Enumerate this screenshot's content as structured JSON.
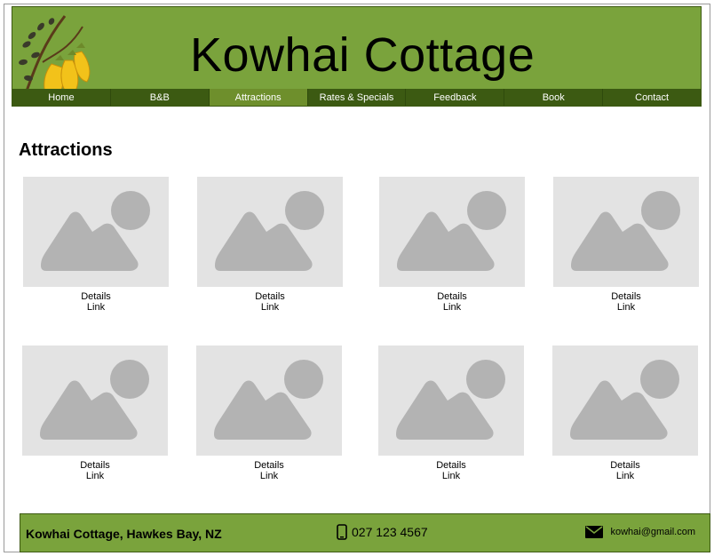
{
  "site": {
    "title": "Kowhai Cottage",
    "brand_color": "#7aa33c",
    "nav_color": "#3c5a12",
    "active_nav_color": "#6e8f2c"
  },
  "nav": {
    "items": [
      {
        "label": "Home"
      },
      {
        "label": "B&B"
      },
      {
        "label": "Attractions",
        "active": true
      },
      {
        "label": "Rates & Specials"
      },
      {
        "label": "Feedback"
      },
      {
        "label": "Book"
      },
      {
        "label": "Contact"
      }
    ]
  },
  "main": {
    "heading": "Attractions",
    "cards": [
      {
        "details": "Details",
        "link": "Link",
        "icon": "image-placeholder-icon"
      },
      {
        "details": "Details",
        "link": "Link",
        "icon": "image-placeholder-icon"
      },
      {
        "details": "Details",
        "link": "Link",
        "icon": "image-placeholder-icon"
      },
      {
        "details": "Details",
        "link": "Link",
        "icon": "image-placeholder-icon"
      },
      {
        "details": "Details",
        "link": "Link",
        "icon": "image-placeholder-icon"
      },
      {
        "details": "Details",
        "link": "Link",
        "icon": "image-placeholder-icon"
      },
      {
        "details": "Details",
        "link": "Link",
        "icon": "image-placeholder-icon"
      },
      {
        "details": "Details",
        "link": "Link",
        "icon": "image-placeholder-icon"
      }
    ]
  },
  "footer": {
    "name": "Kowhai Cottage, Hawkes Bay, NZ",
    "phone": "027 123 4567",
    "phone_icon": "phone-icon",
    "email": "kowhai@gmail.com",
    "email_icon": "mail-icon"
  }
}
